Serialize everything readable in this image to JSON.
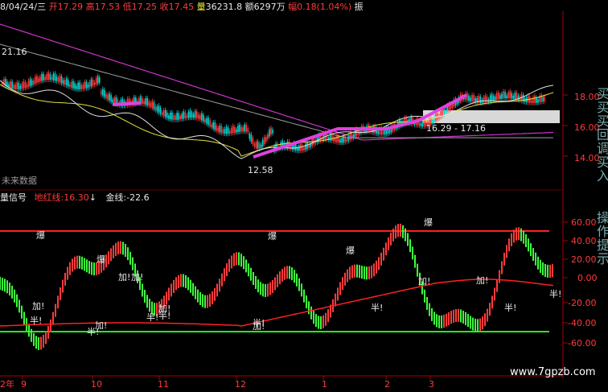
{
  "header": {
    "date": "8/04/24/三",
    "open_label": "开",
    "open": "17.29",
    "high_label": "高",
    "high": "17.53",
    "low_label": "低",
    "low": "17.25",
    "close_label": "收",
    "close": "17.45",
    "vol_label": "量",
    "volume": "36231.8",
    "amount_label": "额",
    "amount": "6297万",
    "change_label": "幅",
    "change": "0.18(1.04%)",
    "extra": "振"
  },
  "price_panel": {
    "left_top_value": "21.16",
    "low_marker": "12.58",
    "range_label": "16.29 - 17.16",
    "future_label": "未来数据",
    "y_ticks": [
      "18.00",
      "16.00",
      "14.00"
    ],
    "side_text": "买买买回调买入"
  },
  "indicator_panel": {
    "title": "量信号",
    "red_line_label": "地红线:",
    "red_line_value": "16.30",
    "gold_line_label": "金线:",
    "gold_line_value": "-22.6",
    "arrow": "↓",
    "y_ticks": [
      "60.00",
      "40.00",
      "20.00",
      "0.00",
      "-20.00",
      "-40.00",
      "-60.00"
    ],
    "side_text": "操作提示",
    "signals": [
      {
        "text": "爆"
      },
      {
        "text": "加!"
      },
      {
        "text": "半!"
      },
      {
        "text": "爆"
      },
      {
        "text": "加!"
      },
      {
        "text": "半!"
      },
      {
        "text": "加!"
      },
      {
        "text": "加!"
      },
      {
        "text": "半!"
      },
      {
        "text": "加!"
      },
      {
        "text": "半!"
      },
      {
        "text": "爆"
      },
      {
        "text": "爆"
      },
      {
        "text": "加!"
      },
      {
        "text": "半!"
      },
      {
        "text": "爆"
      },
      {
        "text": "加!"
      },
      {
        "text": "半!"
      },
      {
        "text": "加!"
      },
      {
        "text": "半!"
      },
      {
        "text": "半!"
      }
    ]
  },
  "x_axis": {
    "labels": [
      "2年",
      "9",
      "10",
      "11",
      "12",
      "1",
      "2",
      "3"
    ]
  },
  "watermark": "www.7gpzb.com",
  "colors": {
    "up": "#ff3b3b",
    "down": "#3cff3c",
    "ma_purple": "#cc33cc",
    "ma_yellow": "#e8e040",
    "ma_white": "#e0e0e0",
    "ma_gray": "#a0a0a0",
    "signal_line": "#ff2020",
    "threshold_red": "#ff2020",
    "threshold_green": "#22ee22"
  }
}
